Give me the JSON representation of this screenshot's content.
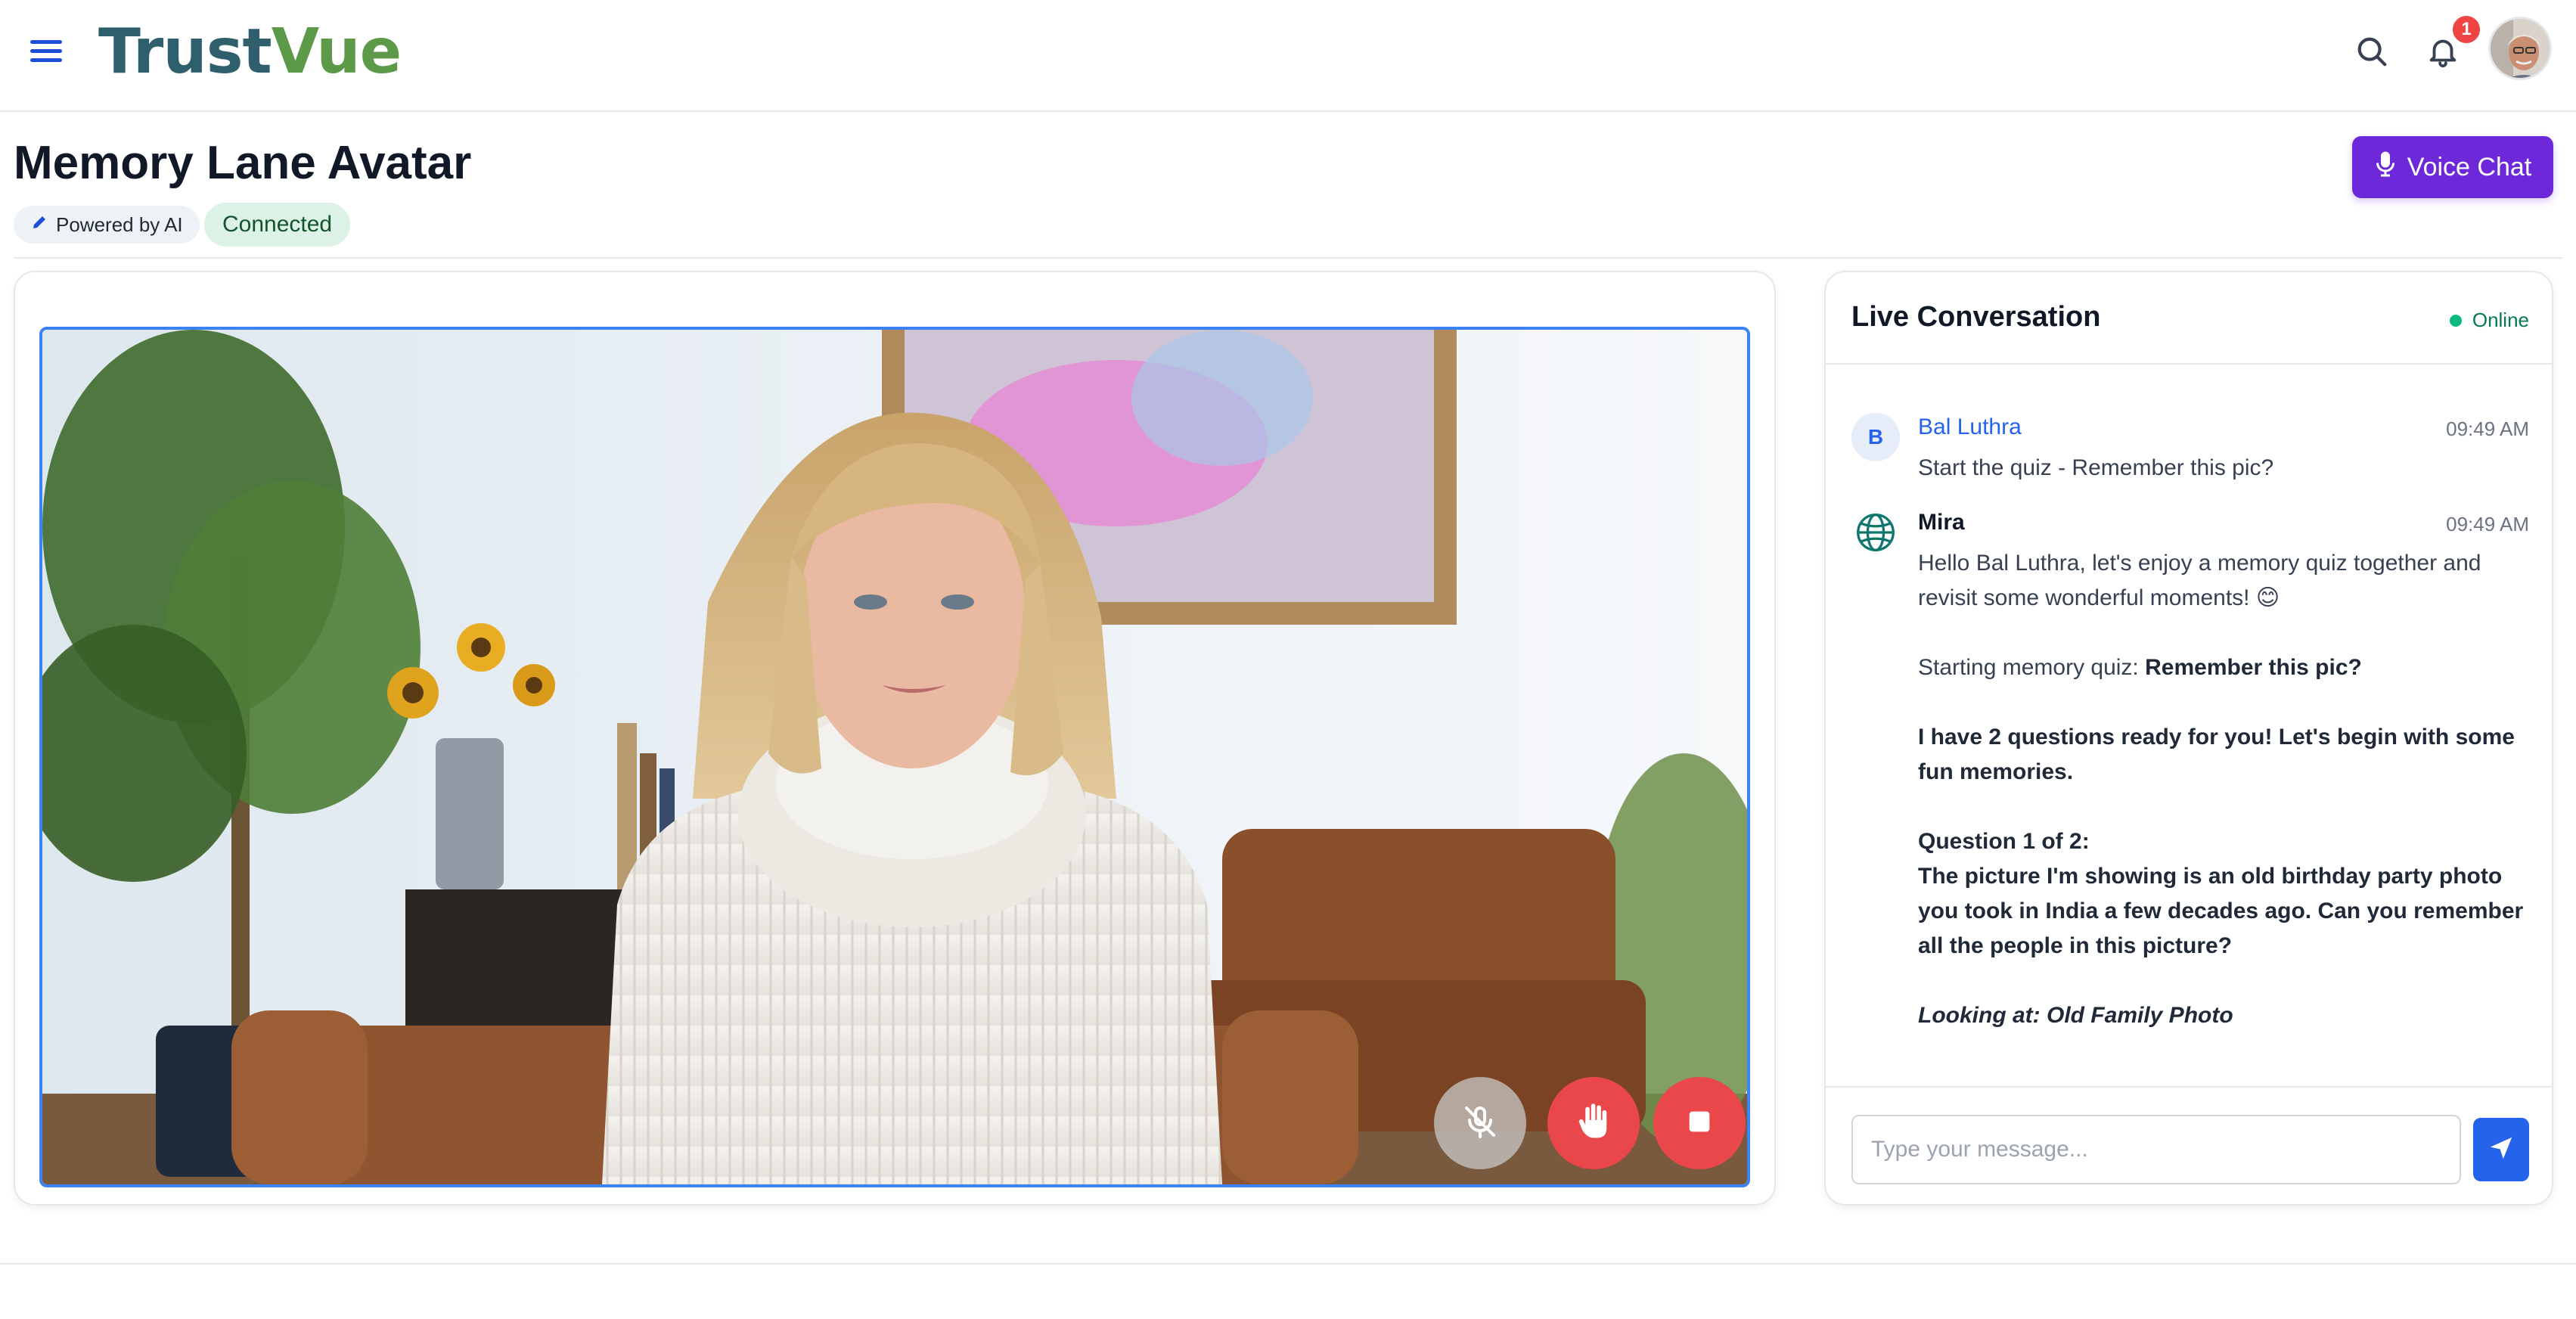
{
  "app": {
    "logo_part1": "Trust",
    "logo_part2": "Vue",
    "notifications_count": "1"
  },
  "icons": {
    "menu": "hamburger-menu-icon",
    "search": "search-icon",
    "notifications": "bell-icon",
    "pencil": "pencil-icon",
    "mic": "microphone-icon",
    "mic_off": "microphone-off-icon",
    "hand": "raise-hand-icon",
    "stop": "stop-icon",
    "send": "paper-plane-icon",
    "bot_avatar": "globe-icon"
  },
  "colors": {
    "accent": "#2563eb",
    "voice_chat": "#6d28d9",
    "danger": "#e9474a",
    "online": "#10b981",
    "connected_bg": "#dcf2e6"
  },
  "page": {
    "title": "Memory Lane Avatar",
    "powered_label": "Powered by AI",
    "status_label": "Connected",
    "voice_chat_label": "Voice Chat"
  },
  "chat": {
    "title": "Live Conversation",
    "status": "Online",
    "input_placeholder": "Type your message...",
    "messages": [
      {
        "sender": "Bal Luthra",
        "initial": "B",
        "time": "09:49 AM",
        "text": "Start the quiz - Remember this pic?"
      },
      {
        "sender": "Mira",
        "time": "09:49 AM",
        "greeting": "Hello Bal Luthra, let's enjoy a memory quiz together and revisit some wonderful moments! 😊",
        "quiz_prefix": "Starting memory quiz: ",
        "quiz_name": "Remember this pic?",
        "ready_line": "I have 2 questions ready for you! Let's begin with some fun memories.",
        "question_header": "Question 1 of 2:",
        "question_text": "The picture I'm showing is an old birthday party photo you took in India a few decades ago. Can you remember all the people in this picture?",
        "looking_at": "Looking at: Old Family Photo"
      }
    ]
  }
}
